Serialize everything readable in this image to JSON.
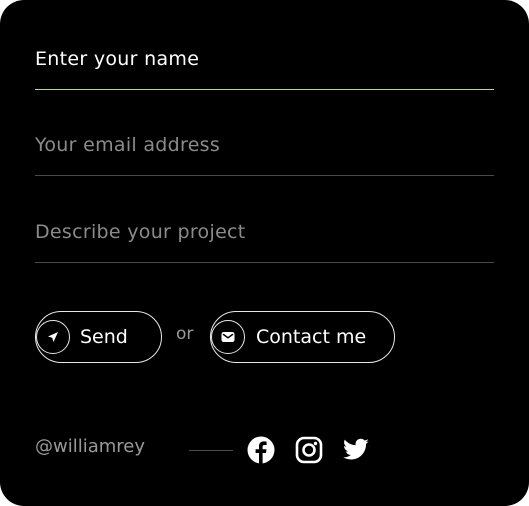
{
  "form": {
    "name_placeholder": "Enter your name",
    "email_placeholder": "Your email address",
    "project_placeholder": "Describe your project",
    "send_label": "Send",
    "or_text": "or",
    "contact_label": "Contact me"
  },
  "footer": {
    "handle": "@williamrey",
    "social": [
      "facebook-icon",
      "instagram-icon",
      "twitter-icon"
    ]
  },
  "colors": {
    "background": "#000000",
    "active_underline": "#b7d98f",
    "inactive_underline": "#4a4a4a",
    "muted_text": "#8b8b8b",
    "text": "#ffffff"
  }
}
